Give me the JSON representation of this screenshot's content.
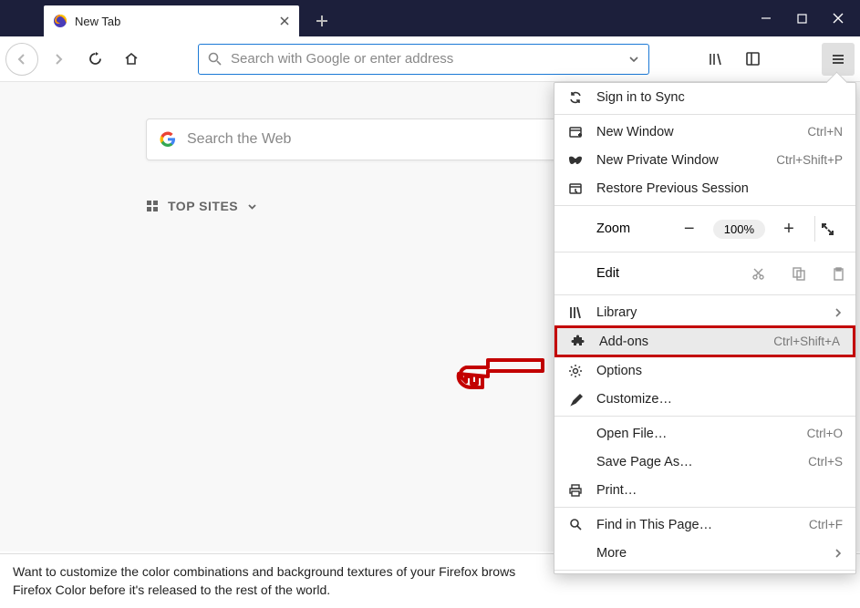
{
  "tab": {
    "title": "New Tab"
  },
  "addressbar": {
    "placeholder": "Search with Google or enter address"
  },
  "content": {
    "search_placeholder": "Search the Web",
    "top_sites_label": "TOP SITES"
  },
  "footer": {
    "line1": "Want to customize the color combinations and background textures of your Firefox brows",
    "line2": "Firefox Color before it's released to the rest of the world."
  },
  "menu": {
    "sign_in": "Sign in to Sync",
    "new_window": {
      "label": "New Window",
      "shortcut": "Ctrl+N"
    },
    "new_private": {
      "label": "New Private Window",
      "shortcut": "Ctrl+Shift+P"
    },
    "restore": "Restore Previous Session",
    "zoom": {
      "label": "Zoom",
      "value": "100%"
    },
    "edit": "Edit",
    "library": "Library",
    "addons": {
      "label": "Add-ons",
      "shortcut": "Ctrl+Shift+A"
    },
    "options": "Options",
    "customize": "Customize…",
    "open_file": {
      "label": "Open File…",
      "shortcut": "Ctrl+O"
    },
    "save_page": {
      "label": "Save Page As…",
      "shortcut": "Ctrl+S"
    },
    "print": "Print…",
    "find": {
      "label": "Find in This Page…",
      "shortcut": "Ctrl+F"
    },
    "more": "More"
  }
}
